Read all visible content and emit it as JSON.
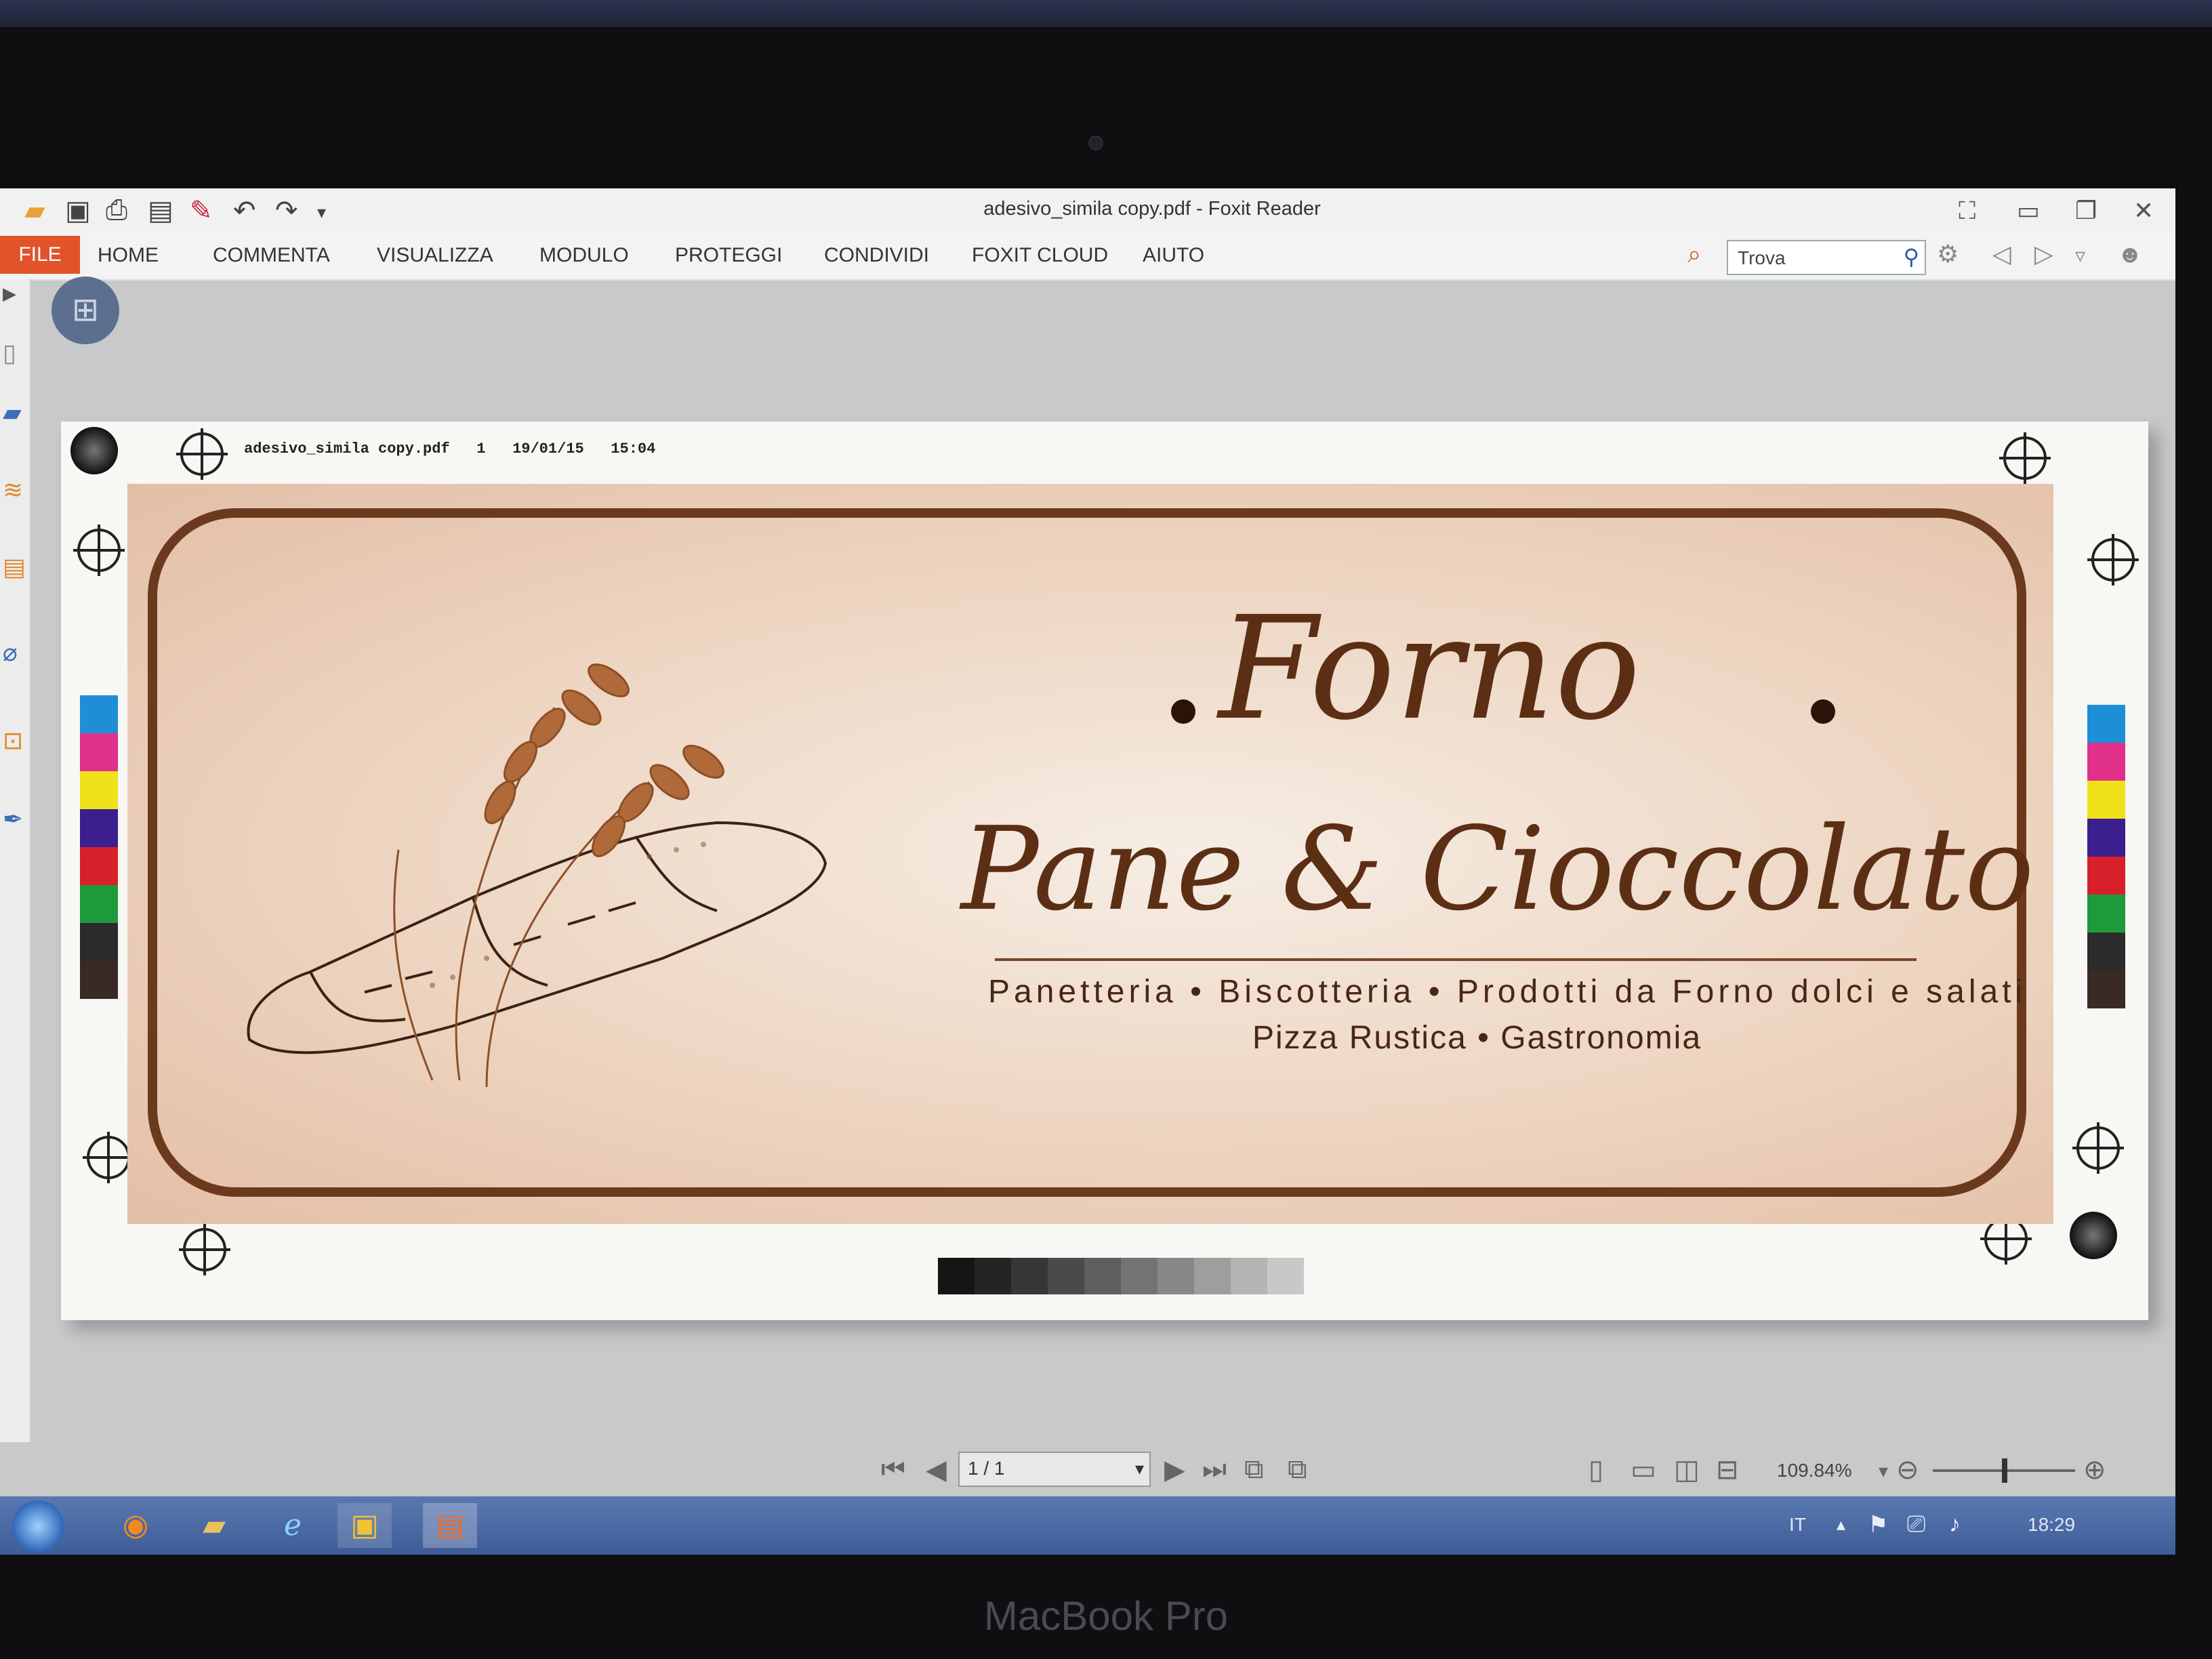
{
  "window": {
    "title": "adesivo_simila copy.pdf - Foxit Reader"
  },
  "ribbon": {
    "file_tab": "FILE",
    "tabs": [
      "HOME",
      "COMMENTA",
      "VISUALIZZA",
      "MODULO",
      "PROTEGGI",
      "CONDIVIDI",
      "FOXIT CLOUD",
      "AIUTO"
    ]
  },
  "search": {
    "value": "Trova"
  },
  "document": {
    "print_info": "adesivo_simila copy.pdf   1   19/01/15   15:04",
    "label": {
      "title": "Forno",
      "subtitle": "Pane & Cioccolato",
      "services_line1": "Panetteria • Biscotteria • Prodotti da Forno dolci e salati",
      "services_line2": "Pizza Rustica • Gastronomia"
    },
    "swatch_colors": [
      "#1e8fd6",
      "#e0308a",
      "#f0e21a",
      "#3b1f8f",
      "#d8202a",
      "#1f9a3a",
      "#2b2b2b",
      "#3a2a25"
    ],
    "gray_steps": [
      "#151515",
      "#242424",
      "#363636",
      "#4a4a4a",
      "#5e5e5e",
      "#737373",
      "#888888",
      "#9e9e9e",
      "#b4b4b4",
      "#c8c8c8"
    ]
  },
  "navigation": {
    "page_value": "1 / 1",
    "zoom": "109.84%"
  },
  "taskbar": {
    "language": "IT",
    "clock": "18:29"
  },
  "device": {
    "brand": "MacBook Pro"
  },
  "colors": {
    "accent_file_tab": "#e2522b",
    "label_brown": "#5c2f15"
  }
}
